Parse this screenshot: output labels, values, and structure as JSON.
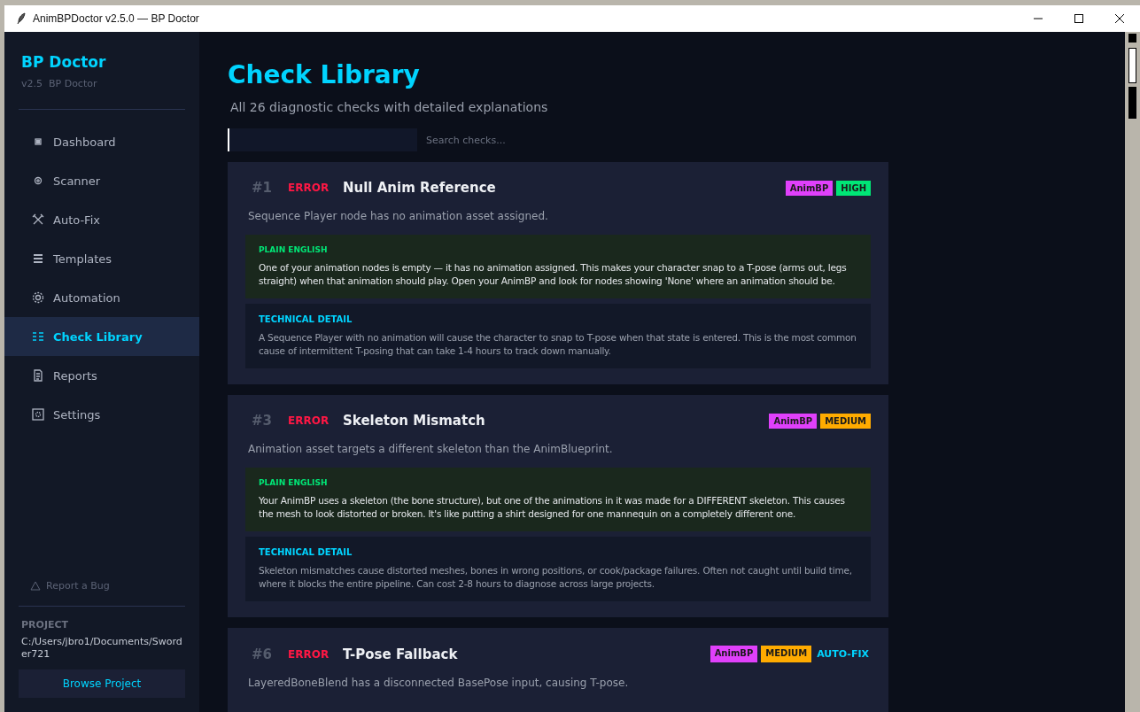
{
  "window": {
    "title": "AnimBPDoctor v2.5.0 — BP Doctor"
  },
  "sidebar": {
    "brand": "BP Doctor",
    "version": "v2.5  BP Doctor",
    "items": [
      {
        "label": "Dashboard",
        "selected": false
      },
      {
        "label": "Scanner",
        "selected": false
      },
      {
        "label": "Auto-Fix",
        "selected": false
      },
      {
        "label": "Templates",
        "selected": false
      },
      {
        "label": "Automation",
        "selected": false
      },
      {
        "label": "Check Library",
        "selected": true
      },
      {
        "label": "Reports",
        "selected": false
      },
      {
        "label": "Settings",
        "selected": false
      }
    ],
    "report_bug": "Report a Bug",
    "project_label": "PROJECT",
    "project_path": "C:/Users/jbro1/Documents/Sworder721",
    "browse_button": "Browse Project"
  },
  "main": {
    "title": "Check Library",
    "subtitle": "All 26 diagnostic checks with detailed explanations",
    "search": {
      "placeholder": "Search checks..."
    },
    "checks": [
      {
        "number": "#1",
        "level": "ERROR",
        "title": "Null Anim Reference",
        "tags": [
          {
            "label": "AnimBP",
            "kind": "badge",
            "color": "#e040fb"
          },
          {
            "label": "HIGH",
            "kind": "badge",
            "color": "#00e676"
          }
        ],
        "summary": "Sequence Player node has no animation asset assigned.",
        "plain_label": "PLAIN ENGLISH",
        "plain": "One of your animation nodes is empty — it has no animation assigned. This makes your character snap to a T-pose (arms out, legs straight) when that animation should play. Open your AnimBP and look for nodes showing 'None' where an animation should be.",
        "technical_label": "TECHNICAL DETAIL",
        "technical": "A Sequence Player with no animation will cause the character to snap to T-pose when that state is entered. This is the most common cause of intermittent T-posing that can take 1-4 hours to track down manually."
      },
      {
        "number": "#3",
        "level": "ERROR",
        "title": "Skeleton Mismatch",
        "tags": [
          {
            "label": "AnimBP",
            "kind": "badge",
            "color": "#e040fb"
          },
          {
            "label": "MEDIUM",
            "kind": "badge",
            "color": "#ffab00"
          }
        ],
        "summary": "Animation asset targets a different skeleton than the AnimBlueprint.",
        "plain_label": "PLAIN ENGLISH",
        "plain": "Your AnimBP uses a skeleton (the bone structure), but one of the animations in it was made for a DIFFERENT skeleton. This causes the mesh to look distorted or broken. It's like putting a shirt designed for one mannequin on a completely different one.",
        "technical_label": "TECHNICAL DETAIL",
        "technical": "Skeleton mismatches cause distorted meshes, bones in wrong positions, or cook/package failures. Often not caught until build time, where it blocks the entire pipeline. Can cost 2-8 hours to diagnose across large projects."
      },
      {
        "number": "#6",
        "level": "ERROR",
        "title": "T-Pose Fallback",
        "tags": [
          {
            "label": "AnimBP",
            "kind": "badge",
            "color": "#e040fb"
          },
          {
            "label": "MEDIUM",
            "kind": "badge",
            "color": "#ffab00"
          },
          {
            "label": "AUTO-FIX",
            "kind": "text",
            "color": "#00d4ff"
          }
        ],
        "summary": "LayeredBoneBlend has a disconnected BasePose input, causing T-pose."
      }
    ]
  }
}
